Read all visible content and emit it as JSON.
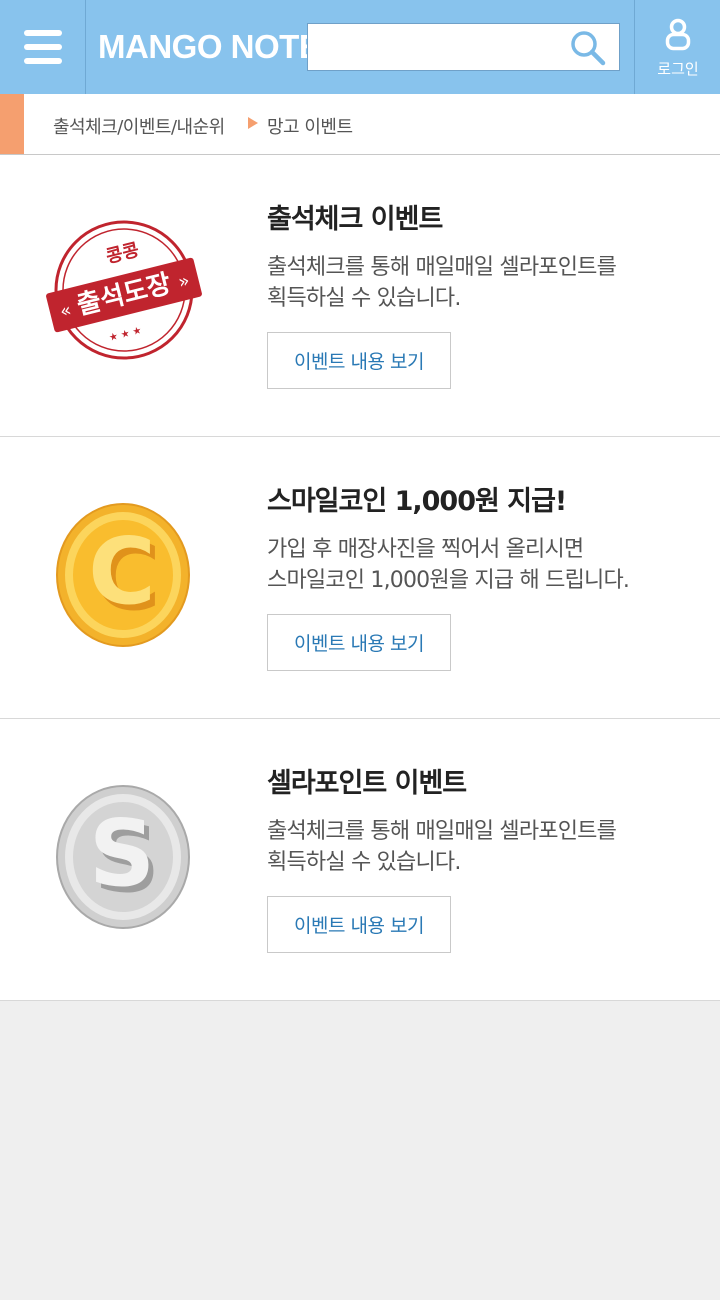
{
  "header": {
    "logo": "MANGO NOTE",
    "search_placeholder": "",
    "login_label": "로그인",
    "icons": {
      "menu": "hamburger-menu-icon",
      "search": "magnifier-icon",
      "login": "user-icon"
    },
    "colors": {
      "bar": "#88c3ed",
      "accent": "#f59f6f"
    }
  },
  "breadcrumb": {
    "parent": "출석체크/이벤트/내순위",
    "current": "망고 이벤트"
  },
  "events": [
    {
      "title": "출석체크 이벤트",
      "desc_lines": [
        "출석체크를 통해 매일매일 셀라포인트를",
        "획득하실 수 있습니다."
      ],
      "button": "이벤트 내용 보기",
      "icon": "attendance-stamp-icon",
      "stamp_top": "콩콩",
      "stamp_main": "출석도장"
    },
    {
      "title": "스마일코인 1,000원 지급!",
      "desc_lines": [
        "가입 후 매장사진을 찍어서 올리시면",
        "스마일코인 1,000원을 지급 해 드립니다."
      ],
      "button": "이벤트 내용 보기",
      "icon": "gold-coin-c-icon",
      "coin_letter": "C"
    },
    {
      "title": "셀라포인트 이벤트",
      "desc_lines": [
        "출석체크를 통해 매일매일 셀라포인트를",
        "획득하실 수 있습니다."
      ],
      "button": "이벤트 내용 보기",
      "icon": "silver-coin-s-icon",
      "coin_letter": "S"
    }
  ]
}
